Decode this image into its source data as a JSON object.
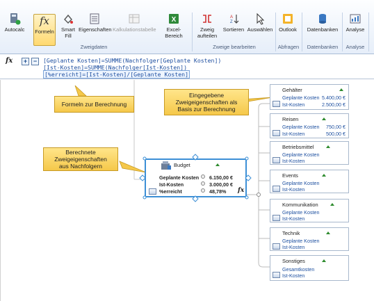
{
  "ribbon": {
    "buttons": [
      {
        "id": "autocalc",
        "label": "Autocalc",
        "icon": "calculator-icon"
      },
      {
        "id": "formeln",
        "label": "Formeln",
        "icon": "fx-icon"
      },
      {
        "id": "smart-fill",
        "label": "Smart\nFill",
        "icon": "smart-fill-icon"
      },
      {
        "id": "eigenschaften",
        "label": "Eigenschaften",
        "icon": "properties-icon"
      },
      {
        "id": "kalkulationstabelle",
        "label": "Kalkulationstabelle",
        "icon": "spreadsheet-icon"
      },
      {
        "id": "excel-bereich",
        "label": "Excel-Bereich",
        "icon": "excel-icon"
      },
      {
        "id": "zweig-aufteilen",
        "label": "Zweig\naufteilen",
        "icon": "split-branch-icon"
      },
      {
        "id": "sortieren",
        "label": "Sortieren",
        "icon": "sort-icon"
      },
      {
        "id": "auswaehlen",
        "label": "Auswählen",
        "icon": "select-cursor-icon"
      },
      {
        "id": "outlook",
        "label": "Outlook",
        "icon": "outlook-icon"
      },
      {
        "id": "datenbanken",
        "label": "Datenbanken",
        "icon": "database-icon"
      },
      {
        "id": "analyse",
        "label": "Analyse",
        "icon": "analysis-icon"
      }
    ],
    "groups": {
      "zweigdaten": "Zweigdaten",
      "zweige_bearbeiten": "Zweige bearbeiten",
      "abfragen": "Abfragen",
      "datenbanken": "Datenbanken",
      "analyse": "Analyse"
    }
  },
  "formula_bar": {
    "fx": "fx",
    "plus": "+",
    "minus": "−",
    "lines": [
      "[Geplante Kosten]=SUMME(Nachfolger[Geplante Kosten])",
      "[Ist-Kosten]=SUMME(Nachfolger[Ist-Kosten])",
      "[%erreicht]=[Ist-Kosten]/[Geplante Kosten]"
    ]
  },
  "callouts": {
    "formeln": "Formeln zur Berechnung",
    "eingegebene": "Eingegebene Zweigeigenschaften als Basis zur Berechnung",
    "berechnete": "Berechnete Zweigeigenschaften aus Nachfolgern"
  },
  "budget": {
    "title": "Budget",
    "rows": [
      {
        "label": "Geplante Kosten",
        "value": "6.150,00 €"
      },
      {
        "label": "Ist-Kosten",
        "value": "3.000,00 €"
      },
      {
        "label": "%erreicht",
        "value": "48,78%"
      }
    ],
    "fx": "fx"
  },
  "branches": [
    {
      "title": "Gehälter",
      "rows": [
        {
          "label": "Geplante Kosten",
          "value": "5.400,00 €"
        },
        {
          "label": "Ist-Kosten",
          "value": "2.500,00 €"
        }
      ]
    },
    {
      "title": "Reisen",
      "rows": [
        {
          "label": "Geplante Kosten",
          "value": "750,00 €"
        },
        {
          "label": "Ist-Kosten",
          "value": "500,00 €"
        }
      ]
    },
    {
      "title": "Betriebsmittel",
      "rows": [
        {
          "label": "Geplante Kosten",
          "value": ""
        },
        {
          "label": "Ist-Kosten",
          "value": ""
        }
      ]
    },
    {
      "title": "Events",
      "rows": [
        {
          "label": "Geplante Kosten",
          "value": ""
        },
        {
          "label": "Ist-Kosten",
          "value": ""
        }
      ]
    },
    {
      "title": "Kommunikation",
      "rows": [
        {
          "label": "Geplante Kosten",
          "value": ""
        },
        {
          "label": "Ist-Kosten",
          "value": ""
        }
      ]
    },
    {
      "title": "Technik",
      "rows": [
        {
          "label": "Geplante Kosten",
          "value": ""
        },
        {
          "label": "Ist-Kosten",
          "value": ""
        }
      ]
    },
    {
      "title": "Sonstiges",
      "rows": [
        {
          "label": "Gesamtkosten",
          "value": ""
        },
        {
          "label": "Ist-Kosten",
          "value": ""
        }
      ]
    }
  ]
}
